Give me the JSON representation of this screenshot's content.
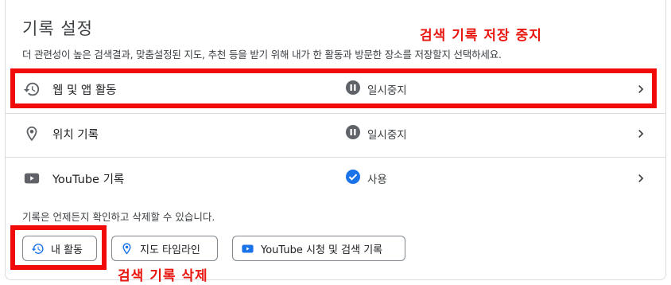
{
  "section": {
    "title": "기록 설정",
    "description": "더 관련성이 높은 검색결과, 맞춤설정된 지도, 추천 등을 받기 위해 내가 한 활동과 방문한 장소를 저장할지 선택하세요."
  },
  "annotations": {
    "top": "검색 기록 저장 중지",
    "bottom": "검색 기록 삭제",
    "color": "#f00a0a"
  },
  "rows": [
    {
      "label": "웹 및 앱 활동",
      "status": "일시중지",
      "icon": "history-icon",
      "status_icon": "pause-icon"
    },
    {
      "label": "위치 기록",
      "status": "일시중지",
      "icon": "location-pin-icon",
      "status_icon": "pause-icon"
    },
    {
      "label": "YouTube 기록",
      "status": "사용",
      "icon": "youtube-icon",
      "status_icon": "check-circle-icon"
    }
  ],
  "note": "기록은 언제든지 확인하고 삭제할 수 있습니다.",
  "chips": [
    {
      "label": "내 활동",
      "icon": "history-icon"
    },
    {
      "label": "지도 타임라인",
      "icon": "location-pin-icon"
    },
    {
      "label": "YouTube 시청 및 검색 기록",
      "icon": "youtube-icon"
    }
  ],
  "colors": {
    "accent_blue": "#1a73e8",
    "icon_gray": "#5f6368",
    "annotation_red": "#e8160f"
  }
}
